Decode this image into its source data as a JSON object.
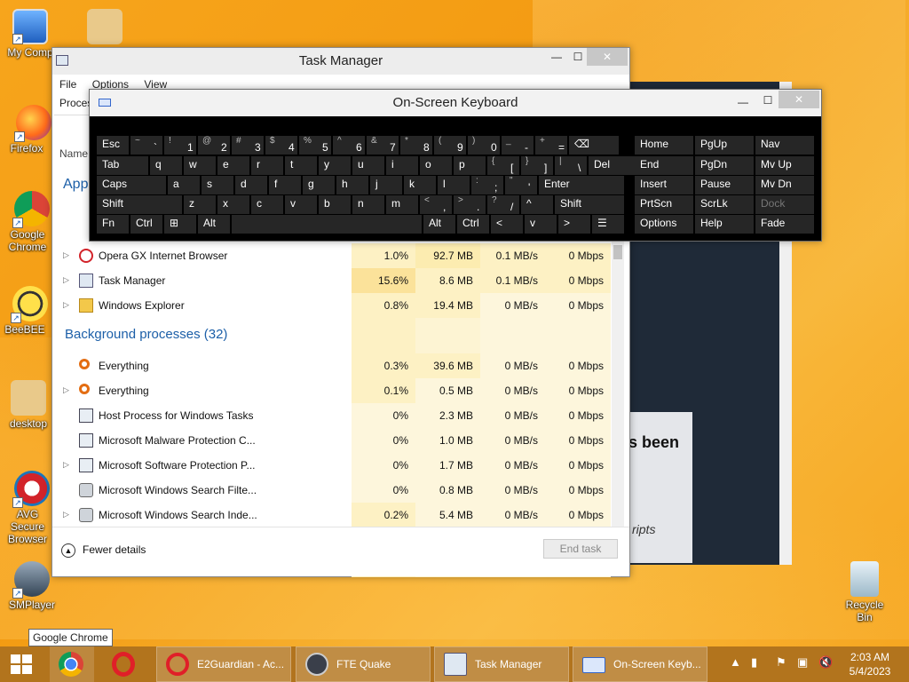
{
  "desktop": {
    "icons": [
      {
        "label": "My Comp",
        "icon": "computer-icon"
      },
      {
        "label": "Firefox",
        "icon": "firefox-icon"
      },
      {
        "label": "Google Chrome",
        "icon": "chrome-icon"
      },
      {
        "label": "BeeBEE",
        "icon": "bee-icon"
      },
      {
        "label": "desktop",
        "icon": "gear-icon"
      },
      {
        "label": "AVG Secure Browser",
        "icon": "avg-icon"
      },
      {
        "label": "SMPlayer",
        "icon": "smplayer-icon"
      },
      {
        "label": "Recycle Bin",
        "icon": "recycle-bin-icon"
      }
    ]
  },
  "tooltip": "Google Chrome",
  "task_manager": {
    "title": "Task Manager",
    "menu": [
      "File",
      "Options",
      "View"
    ],
    "tab_visible": "Proces",
    "col_name": "Name",
    "apps_section": "App",
    "apps": [
      {
        "name": "Opera GX Internet Browser",
        "cpu": "1.0%",
        "mem": "92.7 MB",
        "disk": "0.1 MB/s",
        "net": "0 Mbps",
        "icon": "opera-icon"
      },
      {
        "name": "Task Manager",
        "cpu": "15.6%",
        "mem": "8.6 MB",
        "disk": "0.1 MB/s",
        "net": "0 Mbps",
        "icon": "task-manager-icon"
      },
      {
        "name": "Windows Explorer",
        "cpu": "0.8%",
        "mem": "19.4 MB",
        "disk": "0 MB/s",
        "net": "0 Mbps",
        "icon": "folder-icon"
      }
    ],
    "background_section": "Background processes (32)",
    "background": [
      {
        "name": "Everything",
        "cpu": "0.3%",
        "mem": "39.6 MB",
        "disk": "0 MB/s",
        "net": "0 Mbps",
        "icon": "search-icon"
      },
      {
        "name": "Everything",
        "cpu": "0.1%",
        "mem": "0.5 MB",
        "disk": "0 MB/s",
        "net": "0 Mbps",
        "icon": "search-icon"
      },
      {
        "name": "Host Process for Windows Tasks",
        "cpu": "0%",
        "mem": "2.3 MB",
        "disk": "0 MB/s",
        "net": "0 Mbps",
        "icon": "process-icon"
      },
      {
        "name": "Microsoft Malware Protection C...",
        "cpu": "0%",
        "mem": "1.0 MB",
        "disk": "0 MB/s",
        "net": "0 Mbps",
        "icon": "process-icon"
      },
      {
        "name": "Microsoft Software Protection P...",
        "cpu": "0%",
        "mem": "1.7 MB",
        "disk": "0 MB/s",
        "net": "0 Mbps",
        "icon": "process-icon"
      },
      {
        "name": "Microsoft Windows Search Filte...",
        "cpu": "0%",
        "mem": "0.8 MB",
        "disk": "0 MB/s",
        "net": "0 Mbps",
        "icon": "search-service-icon"
      },
      {
        "name": "Microsoft Windows Search Inde...",
        "cpu": "0.2%",
        "mem": "5.4 MB",
        "disk": "0 MB/s",
        "net": "0 Mbps",
        "icon": "search-service-icon"
      }
    ],
    "fewer_details": "Fewer details",
    "end_task": "End task"
  },
  "background_window": {
    "text1": "s been",
    "text2": "ripts"
  },
  "osk": {
    "title": "On-Screen Keyboard",
    "rows": [
      [
        "Esc",
        "~ `",
        "! 1",
        "@ 2",
        "# 3",
        "$ 4",
        "% 5",
        "^ 6",
        "& 7",
        "* 8",
        "( 9",
        ") 0",
        "_ -",
        "+ =",
        "⌫"
      ],
      [
        "Tab",
        "q",
        "w",
        "e",
        "r",
        "t",
        "y",
        "u",
        "i",
        "o",
        "p",
        "{ [",
        "} ]",
        "| \\",
        "Del"
      ],
      [
        "Caps",
        "a",
        "s",
        "d",
        "f",
        "g",
        "h",
        "j",
        "k",
        "l",
        ": ;",
        "\" '",
        "Enter"
      ],
      [
        "Shift",
        "z",
        "x",
        "c",
        "v",
        "b",
        "n",
        "m",
        "< ,",
        "> .",
        "? /",
        "^",
        "Shift"
      ],
      [
        "Fn",
        "Ctrl",
        "⊞",
        "Alt",
        "",
        "Alt",
        "Ctrl",
        "<",
        "v",
        ">",
        "☰"
      ]
    ],
    "nav_cols": [
      [
        "Home",
        "End",
        "Insert",
        "PrtScn",
        "Options"
      ],
      [
        "PgUp",
        "PgDn",
        "Pause",
        "ScrLk",
        "Help"
      ],
      [
        "Nav",
        "Mv Up",
        "Mv Dn",
        "Dock",
        "Fade"
      ]
    ]
  },
  "taskbar": {
    "tasks": [
      {
        "label": "E2Guardian - Ac...",
        "icon": "opera-icon"
      },
      {
        "label": "FTE Quake",
        "icon": "quake-icon"
      },
      {
        "label": "Task Manager",
        "icon": "task-manager-icon"
      },
      {
        "label": "On-Screen Keyb...",
        "icon": "keyboard-icon"
      }
    ],
    "time": "2:03 AM",
    "date": "5/4/2023"
  }
}
